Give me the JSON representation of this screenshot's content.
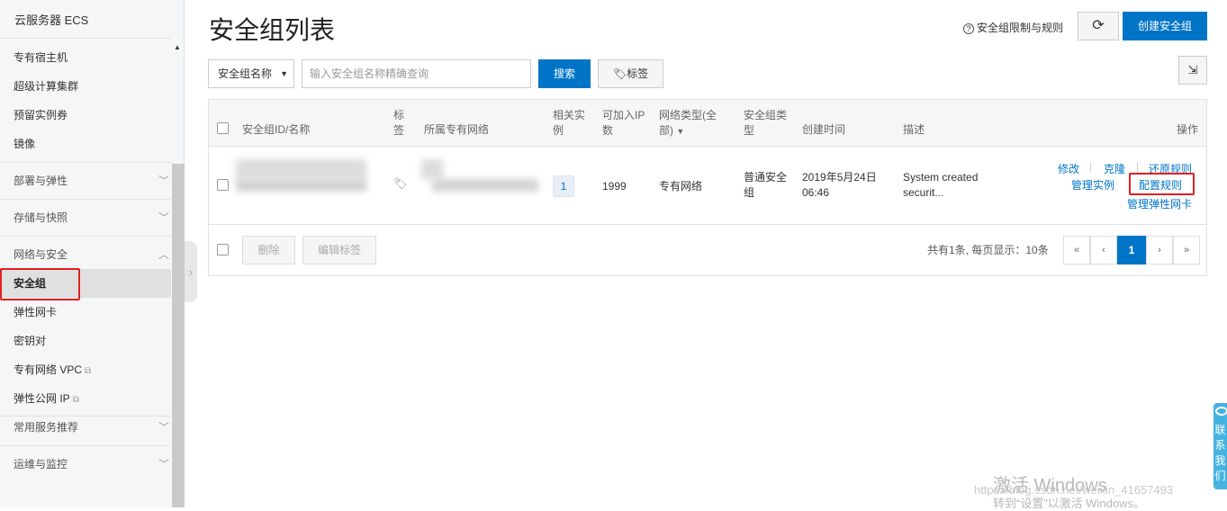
{
  "sidebar": {
    "title": "云服务器 ECS",
    "items": [
      {
        "label": "专有宿主机"
      },
      {
        "label": "超级计算集群"
      },
      {
        "label": "预留实例券"
      },
      {
        "label": "镜像"
      }
    ],
    "groups": {
      "deploy": "部署与弹性",
      "storage": "存储与快照",
      "network": "网络与安全",
      "services": "常用服务推荐",
      "ops": "运维与监控"
    },
    "network_items": {
      "security_group": "安全组",
      "eni": "弹性网卡",
      "keypair": "密钥对",
      "vpc": "专有网络 VPC",
      "eip": "弹性公网 IP"
    }
  },
  "header": {
    "title": "安全组列表",
    "help_link": "安全组限制与规则",
    "refresh_icon": "⟳",
    "create_button": "创建安全组"
  },
  "filter": {
    "select_value": "安全组名称",
    "search_placeholder": "输入安全组名称精确查询",
    "search_button": "搜索",
    "tag_button": "标签"
  },
  "table": {
    "columns": {
      "id_name": "安全组ID/名称",
      "tag_l1": "标",
      "tag_l2": "签",
      "vpc": "所属专有网络",
      "related_l1": "相关实",
      "related_l2": "例",
      "avail_l1": "可加入IP",
      "avail_l2": "数",
      "nettype_l1": "网络类型(全",
      "nettype_l2": "部)",
      "sgtype_l1": "安全组类",
      "sgtype_l2": "型",
      "created": "创建时间",
      "desc": "描述",
      "ops": "操作"
    },
    "row": {
      "related_instances": "1",
      "available_ip": "1999",
      "network_type": "专有网络",
      "sg_type_l1": "普通安全",
      "sg_type_l2": "组",
      "created_l1": "2019年5月24日",
      "created_l2": "06:46",
      "desc_l1": "System created",
      "desc_l2": "securit...",
      "ops": {
        "modify": "修改",
        "clone": "克隆",
        "restore": "还原规则",
        "manage_instances": "管理实例",
        "config_rules": "配置规则",
        "manage_eni": "管理弹性网卡"
      }
    },
    "footer": {
      "delete_button": "删除",
      "edit_tags_button": "编辑标签",
      "summary": "共有1条, 每页显示：10条",
      "pages": {
        "first": "«",
        "prev": "‹",
        "current": "1",
        "next": "›",
        "last": "»"
      }
    }
  },
  "overlay": {
    "contact": "联系我们",
    "win_title": "激活 Windows",
    "win_sub": "转到“设置”以激活 Windows。",
    "watermark": "https://blog.csdn.net/weixin_41657493"
  },
  "colors": {
    "accent": "#0075c7",
    "highlight": "#e02020"
  }
}
